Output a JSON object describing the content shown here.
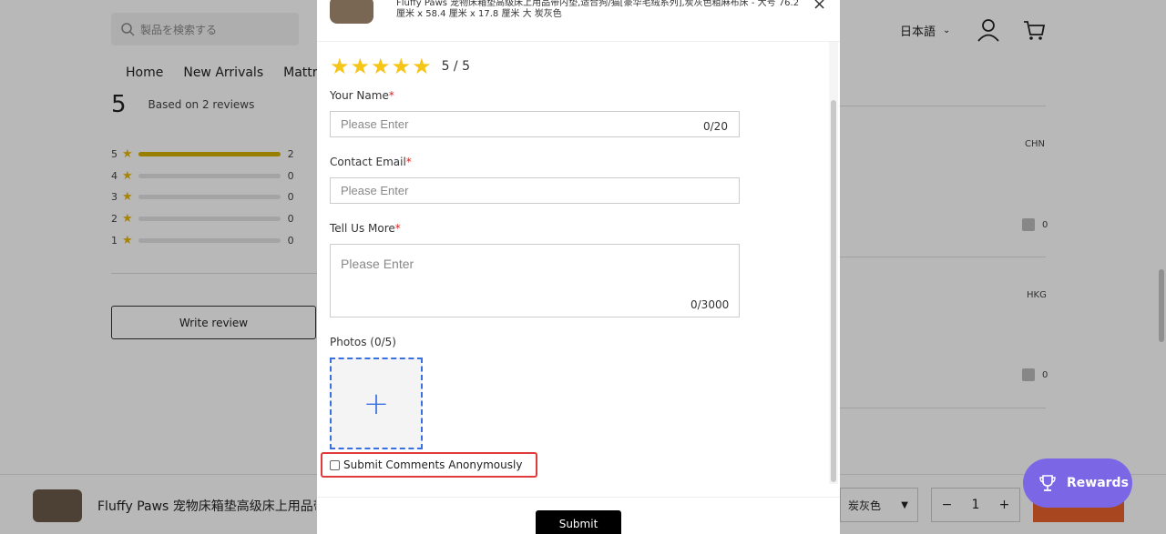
{
  "header": {
    "search_placeholder": "製品を検索する",
    "nav": [
      "Home",
      "New Arrivals",
      "Mattre"
    ],
    "language": "日本語"
  },
  "summary": {
    "average": "5",
    "based_on": "Based on 2 reviews",
    "distribution": [
      {
        "star": "5",
        "count": "2",
        "fraction": 1.0
      },
      {
        "star": "4",
        "count": "0",
        "fraction": 0
      },
      {
        "star": "3",
        "count": "0",
        "fraction": 0
      },
      {
        "star": "2",
        "count": "0",
        "fraction": 0
      },
      {
        "star": "1",
        "count": "0",
        "fraction": 0
      }
    ],
    "write_review": "Write review"
  },
  "reviews": [
    {
      "country": "CHN",
      "likes": "0"
    },
    {
      "country": "HKG",
      "likes": "0"
    }
  ],
  "sticky": {
    "product_title": "Fluffy Paws 宠物床箱垫高级床上用品带",
    "variant": "炭灰色",
    "quantity": "1"
  },
  "modal": {
    "product_title": "Fluffy Paws 宠物床箱垫高级床上用品带内垫,适合狗/猫[豪华毛绒系列],炭灰色粗麻布床 - 大号 76.2 厘米 x 58.4 厘米 x 17.8 厘米 大 炭灰色",
    "close_glyph": "×",
    "rating_text": "5 / 5",
    "rating_value": 5,
    "name_label": "Your Name",
    "name_placeholder": "Please Enter",
    "name_counter": "0/20",
    "email_label": "Contact Email",
    "email_placeholder": "Please Enter",
    "more_label": "Tell Us More",
    "more_placeholder": "Please Enter",
    "more_counter": "0/3000",
    "photos_label": "Photos (0/5)",
    "anonymous_label": "Submit Comments Anonymously",
    "submit": "Submit",
    "required_mark": "*"
  },
  "rewards": {
    "label": "Rewards"
  },
  "colors": {
    "accent_blue": "#3a6fe0",
    "highlight_red": "#e03a3a",
    "star": "#f5c518",
    "rewards": "#7b67e6"
  }
}
